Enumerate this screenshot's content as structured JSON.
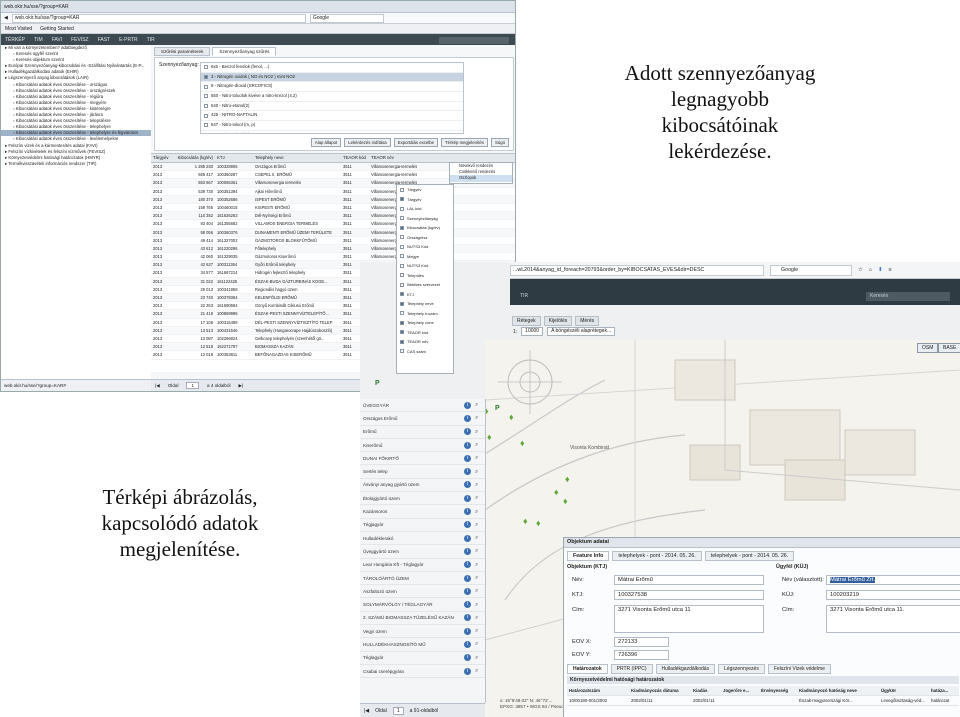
{
  "slide": {
    "top_right_text": [
      "Adott szennyezőanyag",
      "legnagyobb",
      "kibocsátóinak",
      "lekérdezése."
    ],
    "bottom_left_text": [
      "Térképi ábrázolás,",
      "kapcsolódó adatok",
      "megjelenítése."
    ]
  },
  "shot1": {
    "browser": {
      "tab_title": "web.okir.hu/sse/?group=KAR",
      "url": "web.okir.hu/sse/?group=KAR",
      "search_placeholder": "Google",
      "bookmarks": [
        "Most Visited",
        "Getting Started"
      ],
      "menu": [
        "TÉRKÉP",
        "TIM",
        "FAVI",
        "FEVISZ",
        "FAST",
        "E-PRTR",
        "TIR"
      ],
      "app_search_label": "Keresés"
    },
    "tree": [
      {
        "label": "Mi van a környezetemben? adatbiegdező",
        "level": 1,
        "selected": false
      },
      {
        "label": "Keresés ügyfél szerint",
        "level": 2,
        "selected": false
      },
      {
        "label": "Keresés objektum szerint",
        "level": 2,
        "selected": false
      },
      {
        "label": "Európai Szennyezőanyag-kibocsátási és -Szállítási Nyilvántartás (E-P...",
        "level": 1,
        "selected": false
      },
      {
        "label": "Hulladékgazdálkodási adatok (EHIR)",
        "level": 1,
        "selected": false
      },
      {
        "label": "Légszennyező anyag kibocsátások (LAIR)",
        "level": 1,
        "selected": false
      },
      {
        "label": "Kibocsátási adatok éves összesítése - országos",
        "level": 2,
        "selected": false
      },
      {
        "label": "Kibocsátási adatok éves összesítése - országrészek",
        "level": 2,
        "selected": false
      },
      {
        "label": "Kibocsátási adatok éves összesítése - régióra",
        "level": 2,
        "selected": false
      },
      {
        "label": "Kibocsátási adatok éves összesítése - megyére",
        "level": 2,
        "selected": false
      },
      {
        "label": "Kibocsátási adatok éves összesítése - kistérségre",
        "level": 2,
        "selected": false
      },
      {
        "label": "Kibocsátási adatok éves összesítése - járásra",
        "level": 2,
        "selected": false
      },
      {
        "label": "Kibocsátási adatok éves összesítése - településre",
        "level": 2,
        "selected": false
      },
      {
        "label": "Kibocsátási adatok éves összesítése - telephelyre",
        "level": 2,
        "selected": false
      },
      {
        "label": "Kibocsátási adatok éves összesítése - telephelyre és légvárosra",
        "level": 2,
        "selected": true
      },
      {
        "label": "Kibocsátási adatok éves összesítése - levélemelyekre",
        "level": 2,
        "selected": false
      },
      {
        "label": "Felszíni vizek és a kármentesítés adatai (FAVI)",
        "level": 1,
        "selected": false
      },
      {
        "label": "Felszíni vízkivételek és felszíni vízművek (FEVISZ)",
        "level": 1,
        "selected": false
      },
      {
        "label": "Környezetvédelmi hatósági határozatok (HMYR)",
        "level": 1,
        "selected": false
      },
      {
        "label": "Termékvisszavételi információs rendszer (TIR)",
        "level": 1,
        "selected": false
      }
    ],
    "status_url": "web.okir.hu/sse/?group=KAR#",
    "tabs": [
      "Szűrési paraméterek",
      "Szennyezőanyag szűrés"
    ],
    "form": {
      "pollutant_label": "Szennyezőanyag:",
      "pollutants": [
        {
          "label": "6x5 - Benzol fenolok (fenol, ...)",
          "checked": false
        },
        {
          "label": "3 - Nitrogén oxidok ( NO és NO2 ) mint NO2",
          "checked": true
        },
        {
          "label": "9 - Nitrogén-dioxid (SRCOFICS)",
          "checked": false
        },
        {
          "label": "650 - Nitro-toluolok kivéve a nitro-krezol (4,2)",
          "checked": false
        },
        {
          "label": "640 - Nitro-etanol(2)",
          "checked": false
        },
        {
          "label": "425 - NITRO-NAFTALIN",
          "checked": false
        },
        {
          "label": "647 - Nitro-toluol (m, p)",
          "checked": false
        },
        {
          "label": "420 - Nitro-toluol (o)",
          "checked": false
        }
      ],
      "buttons": [
        "Alap állapot",
        "Lekérdezés indítása",
        "Exportálás excelbe",
        "Térkép megjelenítés",
        "Súgó"
      ]
    },
    "table": {
      "columns": [
        "Tárgyév",
        "Kibocsátás (kg/év)",
        "KTJ",
        "Telephely neve",
        "TEAOR kód",
        "TEAOR név"
      ],
      "rows": [
        [
          "2013",
          "1 285 283",
          "100328906",
          "Országos Erőmű",
          "3511",
          "Villamosenergia-termelés"
        ],
        [
          "2013",
          "659 417",
          "100360287",
          "CSEPEL II. ERŐMŰ",
          "3511",
          "Villamosenergia-termelés"
        ],
        [
          "2013",
          "553 667",
          "100065361",
          "Villamosenergia termelés",
          "3511",
          "Villamosenergia-termelés"
        ],
        [
          "2013",
          "539 730",
          "100351394",
          "Ajkai Hőerőmű",
          "3511",
          "Villamosenergia-termelés"
        ],
        [
          "2013",
          "180 370",
          "100352686",
          "ISPEST ERŐMŰ",
          "3511",
          "Villamosenergia-termelés"
        ],
        [
          "2013",
          "159 765",
          "100460015",
          "KISPESTI ERŐMŰ",
          "3511",
          "Villamosenergia-termelés"
        ],
        [
          "2013",
          "110 352",
          "161626263",
          "Dél-Nyírségi Erőmű",
          "3511",
          "Villamosenergia-termelés"
        ],
        [
          "2013",
          "83 404",
          "161355682",
          "VILLAMOS ENERGIA TERMELÉS",
          "3511",
          "Villamosenergia-termelés"
        ],
        [
          "2013",
          "58 056",
          "100360376",
          "DUNAMENTI ERŐMŰ ÜZEMI TERÜLETE",
          "3511",
          "Villamosenergia-termelés"
        ],
        [
          "2013",
          "49 414",
          "161327002",
          "GÁZMOTOROS BLOKKFŰTŐMŰ",
          "3511",
          "Villamosenergia-termelés"
        ],
        [
          "2013",
          "43 612",
          "161220296",
          "Főtelephely",
          "3511",
          "Villamosenergia-termelés"
        ],
        [
          "2013",
          "42 060",
          "161329035",
          "Gázmotoros Kiserőmű",
          "3511",
          "Villamosenergia-termelés"
        ],
        [
          "2013",
          "42 637",
          "100311364",
          "Győri Erőmű telephely",
          "3511",
          "Villamosenergia-termelés"
        ],
        [
          "2013",
          "34 577",
          "161667214",
          "Hidrogén fejlesztő telephely",
          "3511",
          "Villamosenergia-termelés"
        ],
        [
          "2013",
          "31 022",
          "161122425",
          "ÉSZAK-BUDA GÁZTURBINÁS KOGE...",
          "3511",
          "Villamosenergia-termelés"
        ],
        [
          "2013",
          "25 013",
          "100341958",
          "Regionális hagyó üzem",
          "3511",
          "Villamosenergia-termelés"
        ],
        [
          "2013",
          "23 740",
          "100379364",
          "KELENFÖLDI ERŐMŰ",
          "3511",
          "Villamosenergia-termelés"
        ],
        [
          "2013",
          "22 263",
          "161690594",
          "Gönyű Kombinált Ciklusú Erőmű",
          "3511",
          "Villamosenergia-termelés"
        ],
        [
          "2013",
          "21 418",
          "100869995",
          "ÉSZAK-PESTI SZENNYVÍZTELEPÍTŐ...",
          "3511",
          "Villamosenergia-termelés"
        ],
        [
          "2013",
          "17 106",
          "100316498",
          "DÉL-PESTI SZENNYVÍZTISZTÍTÓ TELEP",
          "3511",
          "Villamosenergia-termelés"
        ],
        [
          "2013",
          "13 513",
          "100431546",
          "Telephely (Hungarocrape Hajdúszoboszló)",
          "3511",
          "Villamosenergia-termelés"
        ],
        [
          "2013",
          "13 087",
          "102266824",
          "Gelkcsep telephelyén (szemhétől gö...",
          "3511",
          "Villamosenergia-termelés"
        ],
        [
          "2013",
          "12 518",
          "162271787",
          "BIOMASSZA KAZÁN",
          "3511",
          "Villamosenergia-termelés"
        ],
        [
          "2013",
          "12 018",
          "100353811",
          "BEFŐNAGAZDAS KISERŐMŰ",
          "3511",
          "Villamosenergia-termelés"
        ]
      ]
    },
    "context_menu": [
      "Növekvő rendezés",
      "Csökkenő rendezés",
      "Oszlopok"
    ],
    "columns_menu": [
      {
        "label": "Tárgyév",
        "checked": false
      },
      {
        "label": "Tárgyév",
        "checked": true
      },
      {
        "label": "LAL kód",
        "checked": false
      },
      {
        "label": "Szennyezőanyag",
        "checked": false
      },
      {
        "label": "Kibocsátás (kg/év)",
        "checked": true
      },
      {
        "label": "Országrész",
        "checked": false
      },
      {
        "label": "NUTS3 Kód",
        "checked": false
      },
      {
        "label": "Megye",
        "checked": false
      },
      {
        "label": "NUTS3 Kód",
        "checked": false
      },
      {
        "label": "Település",
        "checked": false
      },
      {
        "label": "Illetékes szervezet",
        "checked": false
      },
      {
        "label": "KTJ",
        "checked": true
      },
      {
        "label": "Telephely neve",
        "checked": true
      },
      {
        "label": "Telephely ir.szám",
        "checked": false
      },
      {
        "label": "Telephely címe",
        "checked": true
      },
      {
        "label": "TEAOR kód",
        "checked": true
      },
      {
        "label": "TEAOR név",
        "checked": true
      },
      {
        "label": "CAS szám",
        "checked": false
      }
    ],
    "pager": {
      "page_label": "Oldal",
      "page_value": "1",
      "of_label": "a 4 oldalból",
      "summary": "1 - 25 sorok látható a 90-ből(b)"
    }
  },
  "shot2": {
    "url": "...wL2014&anyag_id_foreach=20793&order_by=KIBOCSATAS_EVES&dir=DESC",
    "search_placeholder": "Google",
    "app_tab": "TIR",
    "app_search": "Keresés",
    "map_tabs": [
      "Rétegek",
      "Kijelölés",
      "Mérés"
    ],
    "scale_label": "1:",
    "scale_value": "10000",
    "address_placeholder": "A böngészéli alaprétegek...",
    "base_buttons": [
      "OSM",
      "BASE"
    ],
    "layers": [
      "ÜVEGGYÁR",
      "Országos Erőmű",
      "Erőmű",
      "Kiserőmű",
      "DUNAI FŐKIRTŐ",
      "Sertés telep",
      "Ásványi anyag gyártó üzem",
      "Étolajgyártó üzem",
      "Kazánsoros",
      "Tégjagyár",
      "Hulladéklerakó",
      "Üveggyártó üzem",
      "Lear Hungária Kft - Téglagyár",
      "TÁROLÓÁRTÓ ÜZEM",
      "Aszfaltozó üzem",
      "SOLYMÁRVÖLGY / TÉGLAGYÁR",
      "2. SZÁMÚ BIOMASSZA TÜZELÉSŰ KAZÁN",
      "Vegyi üzem",
      "HULLADÉKHASZNOSÍTÓ MŰ",
      "Téglagyár",
      "Csabai cserépgyára"
    ],
    "pager": {
      "page_label": "Oldal",
      "page_value": "1",
      "of_label": "a 91-oldalból"
    },
    "coords": [
      "x: 19°6'48.02\"  N: 46°72'...",
      "EPSG: 3857 • WGS 84 / Pseudo..."
    ],
    "map_labels": {
      "town": "Visonta Kombinát"
    },
    "panel": {
      "title": "Objektum adatai",
      "tabs": [
        "Feature Info",
        "telephelyek - pont - 2014. 05. 26.",
        "telephelyek - pont - 2014. 05. 26."
      ],
      "object_header": "Objektum (KTJ)",
      "client_header": "Ügyfél (KÜJ)",
      "name_label": "Név:",
      "name_value": "Mátrai Erőmű",
      "ktj_label": "KTJ:",
      "ktj_value": "100327538",
      "address_label": "Cím:",
      "address_value": "3271 Visonta Erőmű utca 11",
      "client_name_label": "Név (választott):",
      "client_name_value": "Mátrai Erőmű Zrt.",
      "kuj_label": "KÜJ:",
      "kuj_value": "100203219",
      "client_address_label": "Cím:",
      "client_address_value": "3271 Visonta Erőmű utca 11.",
      "eovx_label": "EOV X:",
      "eovx_value": "272133",
      "eovy_label": "EOV Y:",
      "eovy_value": "726396",
      "lower_tabs": [
        "Határozatok",
        "PRTR (IPPC)",
        "Hulladékgazdálkodás",
        "Légszennyezés",
        "Felszíni Vizek védelme"
      ],
      "sub_title": "Környezetvédelmi hatósági határozatok",
      "table_columns": [
        "Határozatszám",
        "Kiadmányozás dátuma",
        "Kiadás",
        "Jogerőre e...",
        "Érvényesség",
        "Kiadmányozó hatóság neve",
        "Ügykör",
        "hatáza..."
      ],
      "table_rows": [
        [
          "10/00180-001/2002",
          "2002/01/11",
          "2002/01/11",
          "",
          "",
          "Észak-magyarországi Kör...",
          "Levegőtisztaság-véd...",
          "határozat"
        ]
      ]
    }
  },
  "colors": {
    "app_bar_dark": "#2f3b42",
    "selection_blue": "#315f9b",
    "info_blue": "#3a6fb0",
    "marker_green": "#5fa838"
  }
}
